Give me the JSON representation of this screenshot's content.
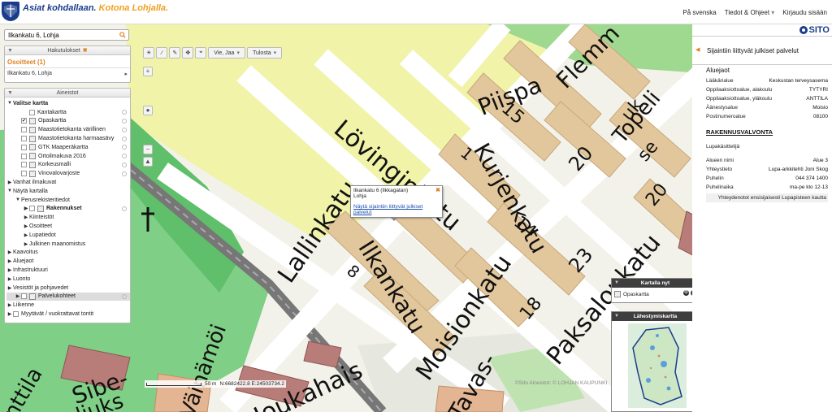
{
  "header": {
    "slogan_part1": "Asiat kohdallaan.",
    "slogan_part2": "Kotona Lohjalla.",
    "nav": {
      "language": "På svenska",
      "info": "Tiedot & Ohjeet",
      "login": "Kirjaudu sisään"
    }
  },
  "toolbar": {
    "share_label": "Vie, Jaa",
    "print_label": "Tulosta"
  },
  "search": {
    "value": "Ilkankatu 6, Lohja"
  },
  "results_panel": {
    "title": "Hakutulokset",
    "section": "Osoitteet (1)",
    "item": "Ilkankatu 6, Lohja"
  },
  "datasets_panel": {
    "title": "Aineistot",
    "rows": [
      {
        "label": "Valitse kartta",
        "arrow": "▼",
        "indent": 0,
        "bold": true
      },
      {
        "label": "Kantakartta",
        "indent": 2,
        "cb": true,
        "icon": false,
        "checked": false
      },
      {
        "label": "Opaskartta",
        "indent": 1,
        "cb": true,
        "icon": true,
        "checked": true
      },
      {
        "label": "Maastotietokanta värillinen",
        "indent": 1,
        "cb": true,
        "icon": true,
        "checked": false
      },
      {
        "label": "Maastotietokanta harmaasävy",
        "indent": 1,
        "cb": true,
        "icon": true,
        "checked": false
      },
      {
        "label": "GTK Maaperäkartta",
        "indent": 1,
        "cb": true,
        "icon": true,
        "checked": false
      },
      {
        "label": "Ortoilmakuva 2016",
        "indent": 1,
        "cb": true,
        "icon": true,
        "checked": false
      },
      {
        "label": "Korkeusmalli",
        "indent": 1,
        "cb": true,
        "icon": true,
        "checked": false
      },
      {
        "label": "Vinovalovarjoste",
        "indent": 1,
        "cb": true,
        "icon": true,
        "checked": false
      },
      {
        "label": "Vanhat ilmakuvat",
        "arrow": "▶",
        "indent": 0,
        "bold": false
      },
      {
        "label": "Näytä kartalla",
        "arrow": "▼",
        "indent": 0,
        "bold": false
      },
      {
        "label": "Perusrekisteritiedot",
        "arrow": "▼",
        "indent": 1,
        "bold": false
      },
      {
        "label": "Rakennukset",
        "arrow": "▶",
        "indent": 2,
        "cb": true,
        "icon": true,
        "bold": true
      },
      {
        "label": "Kiinteistöt",
        "arrow": "▶",
        "indent": 2
      },
      {
        "label": "Osoitteet",
        "arrow": "▶",
        "indent": 2
      },
      {
        "label": "Lupatiedot",
        "arrow": "▶",
        "indent": 2
      },
      {
        "label": "Julkinen maanomistus",
        "arrow": "▶",
        "indent": 2
      },
      {
        "label": "Kaavoitus",
        "arrow": "▶",
        "indent": 0
      },
      {
        "label": "Aluejaot",
        "arrow": "▶",
        "indent": 0
      },
      {
        "label": "Infrastruktuuri",
        "arrow": "▶",
        "indent": 0
      },
      {
        "label": "Luonto",
        "arrow": "▶",
        "indent": 0
      },
      {
        "label": "Vesistöt ja pohjavedet",
        "arrow": "▶",
        "indent": 0
      },
      {
        "label": "Palvelukohteet",
        "arrow": "▶",
        "indent": 1,
        "cb": true,
        "icon": true,
        "selected": true
      },
      {
        "label": "Liikenne",
        "arrow": "▶",
        "indent": 0
      },
      {
        "label": "Myytävät / vuokrattavat tontit",
        "arrow": "▶",
        "indent": 0,
        "cb": true
      }
    ]
  },
  "popup": {
    "line1": "Ilkankatu 6 (Ilkkagatan)",
    "line2": "Lohja",
    "link": "Näytä sijaintiin liittyvät julkiset palvelut"
  },
  "map_labels": {
    "streets": [
      "Lövinginkatu",
      "Ilkankatu",
      "Lallinkatu",
      "Moisionkatu",
      "Paksalonkatu",
      "Kurjenkatu",
      "Flemm",
      "Topeli",
      "Piispa",
      "Joukahais",
      "Väinämöi",
      "Sibe-",
      "liuks",
      "Tavas-",
      "nttila"
    ],
    "house_numbers": [
      "15",
      "20",
      "14",
      "23",
      "20",
      "18",
      "8",
      "1",
      "uk",
      "se"
    ]
  },
  "map_on_map": {
    "title": "Kartalla nyt",
    "layer": "Opaskartta"
  },
  "overview": {
    "title": "Lähestymiskartta"
  },
  "scale": {
    "label": "50 m",
    "coords": "N:6682422.8 E:24503734.2"
  },
  "copyright": "©Sito Aineistot: © LOHJAN KAUPUNKI",
  "right_panel": {
    "logo": "SITO",
    "title": "Sijaintiin liittyvät julkiset palvelut",
    "section1": "Aluejaot",
    "aluejaot": [
      {
        "k": "Lääkärialue",
        "v": "Keskustan terveysasema"
      },
      {
        "k": "Oppilaaksiottoalue, alakoulu",
        "v": "TYTYRI"
      },
      {
        "k": "Oppilaaksiottoalue, yläkoulu",
        "v": "ANTTILA"
      },
      {
        "k": "Äänestysalue",
        "v": "Moisio"
      },
      {
        "k": "Postinumeroalue",
        "v": "08100"
      }
    ],
    "section2": "RAKENNUSVALVONTA",
    "subsection": "Lupakäsittelijä",
    "rakennus": [
      {
        "k": "Alueen nimi",
        "v": "Alue 3"
      },
      {
        "k": "Yhteystieto",
        "v": "Lupa-arkkitehti Joni Skog"
      },
      {
        "k": "Puhelin",
        "v": "044 374 1400"
      },
      {
        "k": "Puhelinaika",
        "v": "ma-pe klo 12-13"
      }
    ],
    "note": "Yhteydenotot ensisijaisesti Lupapisteen kautta"
  }
}
